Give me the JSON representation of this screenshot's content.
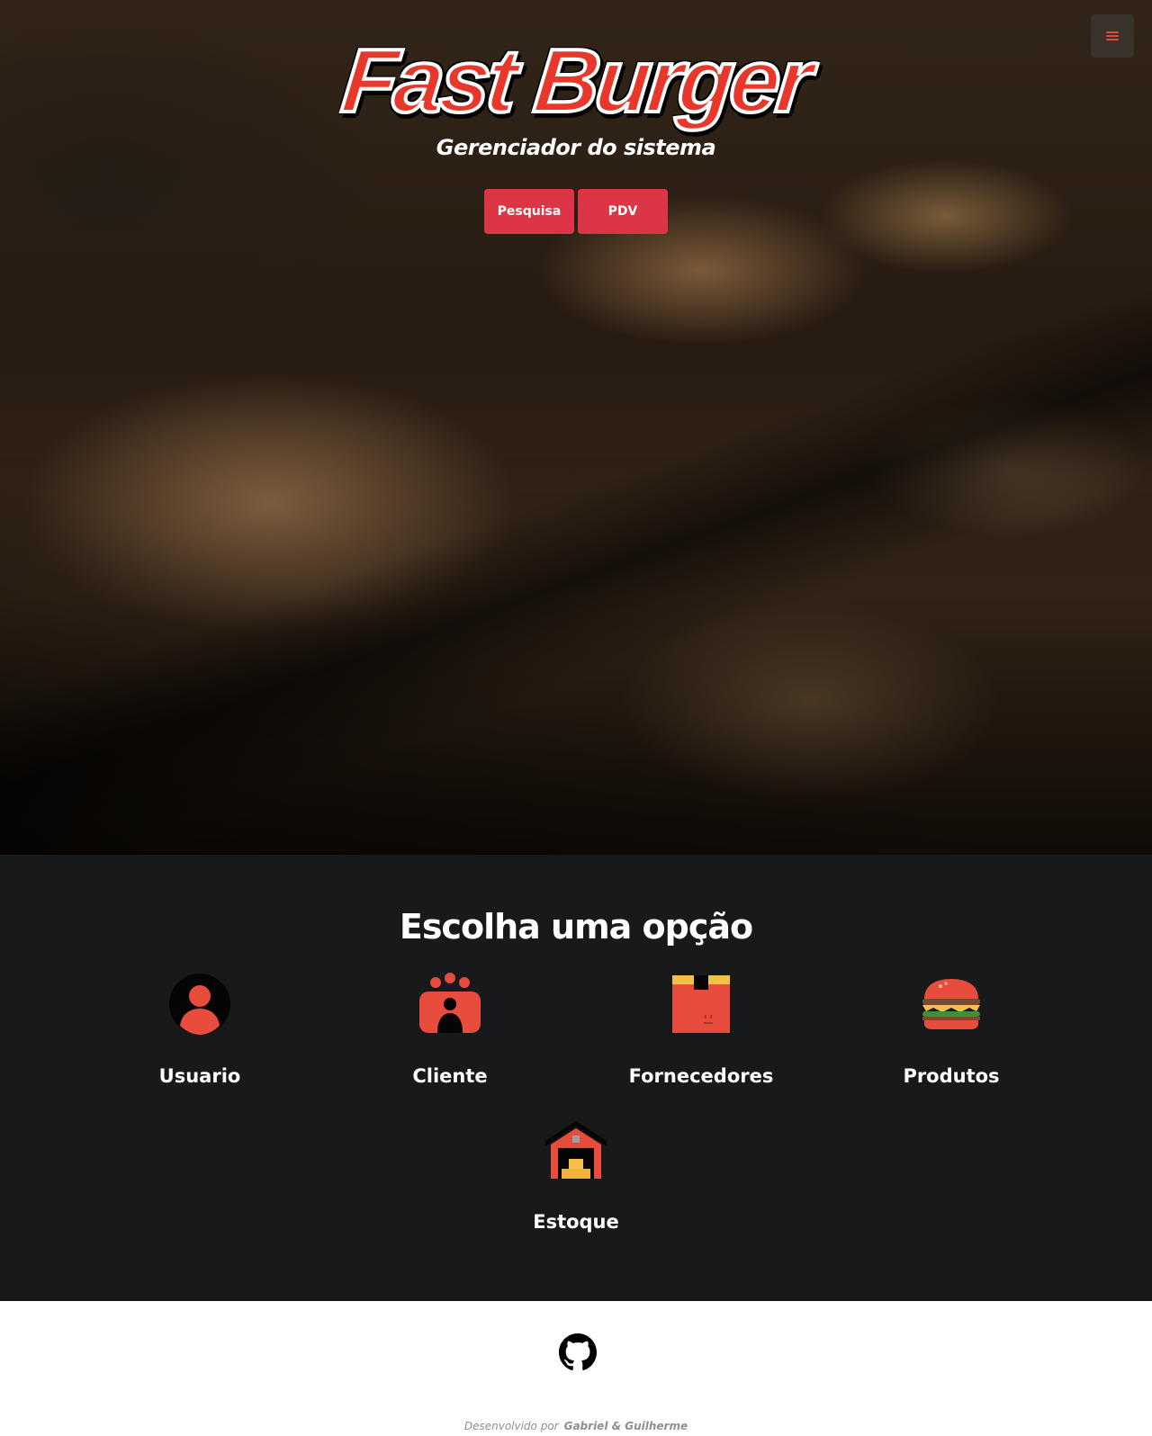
{
  "hero": {
    "logo_text": "Fast Burger",
    "subtitle": "Gerenciador do sistema",
    "buttons": [
      {
        "label": "Pesquisa"
      },
      {
        "label": "PDV"
      }
    ]
  },
  "menu": {
    "icon": "hamburger-menu-icon"
  },
  "options": {
    "title": "Escolha uma opção",
    "items": [
      {
        "label": "Usuario",
        "icon": "user-icon"
      },
      {
        "label": "Cliente",
        "icon": "customers-group-icon"
      },
      {
        "label": "Fornecedores",
        "icon": "box-icon"
      },
      {
        "label": "Produtos",
        "icon": "burger-icon"
      },
      {
        "label": "Estoque",
        "icon": "warehouse-icon"
      }
    ]
  },
  "footer": {
    "github_icon": "github-icon",
    "developed_by": "Desenvolvido por",
    "authors": "Gabriel & Guilherme"
  },
  "colors": {
    "accent": "#dc3545",
    "brand_red": "#e8372b",
    "options_bg": "#18191b"
  }
}
